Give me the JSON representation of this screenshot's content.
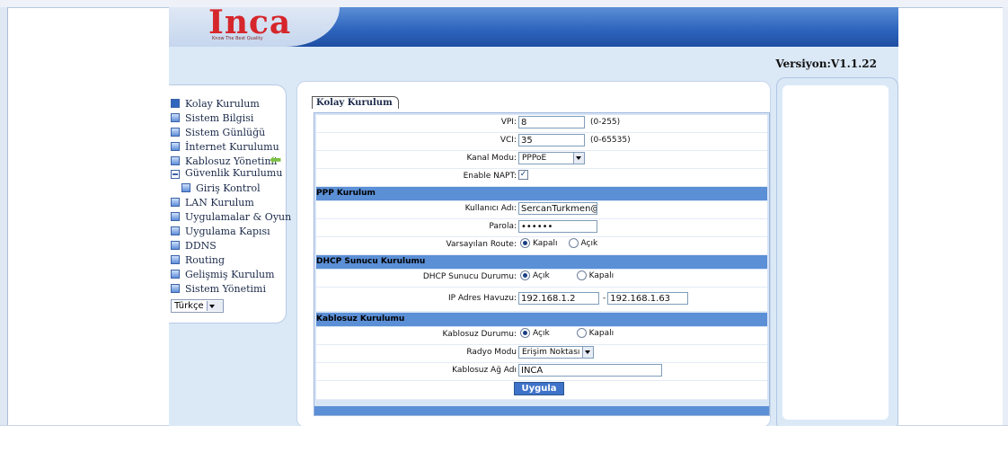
{
  "brand": {
    "logo_text": "Inca",
    "tagline": "Know The Best Quality"
  },
  "version_label": "Versiyon:V1.1.22",
  "menu": {
    "items": [
      {
        "label": "Kolay Kurulum",
        "icon": "arrow-icon"
      },
      {
        "label": "Sistem Bilgisi"
      },
      {
        "label": "Sistem Günlüğü"
      },
      {
        "label": "İnternet Kurulumu"
      },
      {
        "label": "Kablosuz Yönetimi"
      },
      {
        "label": "Güvenlik Kurulumu",
        "icon": "minus-icon"
      },
      {
        "label": "Giriş Kontrol"
      },
      {
        "label": "LAN Kurulum"
      },
      {
        "label": "Uygulamalar & Oyun"
      },
      {
        "label": "Uygulama Kapısı"
      },
      {
        "label": "DDNS"
      },
      {
        "label": "Routing"
      },
      {
        "label": "Gelişmiş Kurulum"
      },
      {
        "label": "Sistem Yönetimi"
      }
    ],
    "language": "Türkçe"
  },
  "form": {
    "tab": "Kolay Kurulum",
    "vpi": {
      "label": "VPI:",
      "value": "8",
      "hint": "(0-255)"
    },
    "vci": {
      "label": "VCI:",
      "value": "35",
      "hint": "(0-65535)"
    },
    "kanal": {
      "label": "Kanal Modu:",
      "value": "PPPoE"
    },
    "napt": {
      "label": "Enable NAPT:",
      "checked": true
    },
    "ppp_section": "PPP Kurulum",
    "kullanici": {
      "label": "Kullanıcı Adı:",
      "value": "SercanTurkmen@ttn"
    },
    "parola": {
      "label": "Parola:",
      "value": "••••••"
    },
    "route": {
      "label": "Varsayılan Route:",
      "opt1": "Kapalı",
      "opt2": "Açık",
      "selected": "Kapalı"
    },
    "dhcp_section": "DHCP Sunucu Kurulumu",
    "dhcp_durum": {
      "label": "DHCP Sunucu Durumu:",
      "opt1": "Açık",
      "opt2": "Kapalı",
      "selected": "Açık"
    },
    "ip_havuz": {
      "label": "IP Adres Havuzu:",
      "start": "192.168.1.2",
      "sep": "-",
      "end": "192.168.1.63"
    },
    "wifi_section": "Kablosuz Kurulumu",
    "wifi_durum": {
      "label": "Kablosuz Durumu:",
      "opt1": "Açık",
      "opt2": "Kapalı",
      "selected": "Açık"
    },
    "radyo": {
      "label": "Radyo Modu",
      "value": "Erişim Noktası"
    },
    "ssid": {
      "label": "Kablosuz Ağ Adı",
      "value": "INCA"
    },
    "submit": "Uygula"
  }
}
